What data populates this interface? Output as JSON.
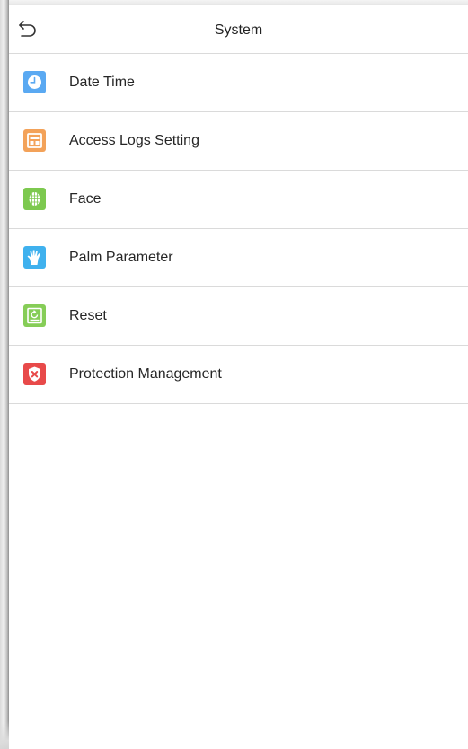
{
  "header": {
    "title": "System",
    "back_icon": "back-arrow-icon"
  },
  "menu": {
    "items": [
      {
        "label": "Date Time",
        "icon": "clock-icon",
        "color": "#5aa9f2"
      },
      {
        "label": "Access Logs Setting",
        "icon": "logs-icon",
        "color": "#f3a259"
      },
      {
        "label": "Face",
        "icon": "face-icon",
        "color": "#7dc94f"
      },
      {
        "label": "Palm Parameter",
        "icon": "palm-icon",
        "color": "#3fb1ee"
      },
      {
        "label": "Reset",
        "icon": "reset-icon",
        "color": "#86cd57"
      },
      {
        "label": "Protection Management",
        "icon": "shield-icon",
        "color": "#e84a4a"
      }
    ]
  }
}
